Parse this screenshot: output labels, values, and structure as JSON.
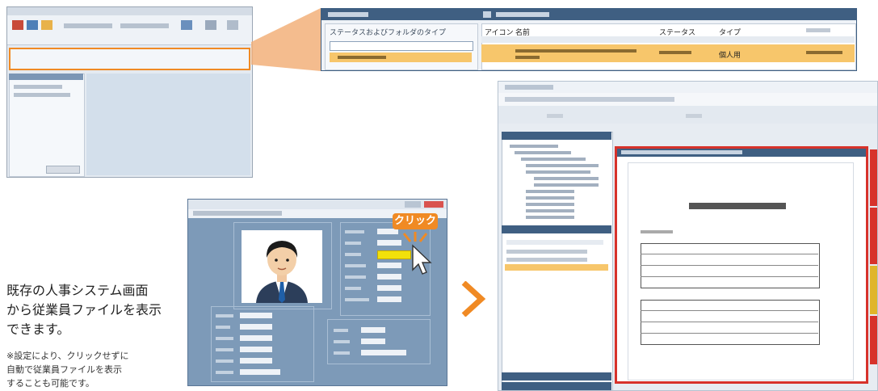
{
  "caption": {
    "main_lines": [
      "既存の人事システム画面",
      "から従業員ファイルを表示",
      "できます。"
    ],
    "note_lines": [
      "※設定により、クリックせずに",
      "自動で従業員ファイルを表示",
      "することも可能です。"
    ]
  },
  "callout": {
    "click_label": "クリック"
  },
  "zoom_panel": {
    "section_title": "ステータスおよびフォルダのタイプ",
    "headers": [
      "アイコン",
      "名前",
      "ステータス",
      "タイプ"
    ],
    "row_type": "個人用"
  },
  "colors": {
    "accent_orange": "#f08a24",
    "highlight_row": "#f7c66b",
    "doc_frame_red": "#d7322b",
    "hr_window_bg": "#7d9ab8",
    "zoom_header": "#3f5f82"
  },
  "icons": [
    "avatar-photo",
    "mouse-cursor-icon",
    "arrow-right-icon",
    "click-burst-icon"
  ]
}
